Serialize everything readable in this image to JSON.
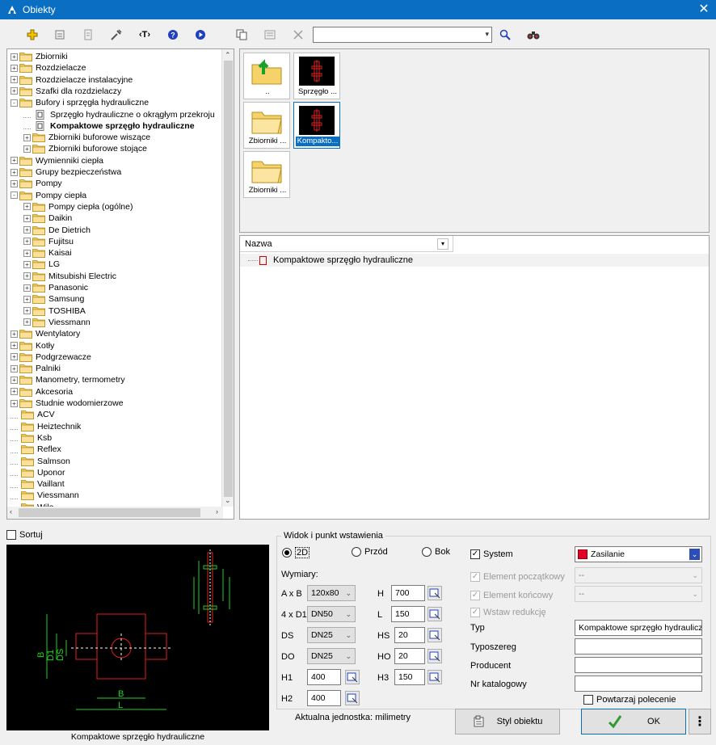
{
  "window": {
    "title": "Obiekty",
    "close": "✕"
  },
  "toolbar": {
    "search_value": ""
  },
  "tree": {
    "items": [
      {
        "label": "Zbiorniki",
        "level": 0,
        "expander": "+",
        "icon": "folder"
      },
      {
        "label": "Rozdzielacze",
        "level": 0,
        "expander": "+",
        "icon": "folder"
      },
      {
        "label": "Rozdzielacze instalacyjne",
        "level": 0,
        "expander": "+",
        "icon": "folder"
      },
      {
        "label": "Szafki dla rozdzielaczy",
        "level": 0,
        "expander": "+",
        "icon": "folder"
      },
      {
        "label": "Bufory i sprzęgła hydrauliczne",
        "level": 0,
        "expander": "-",
        "icon": "folder"
      },
      {
        "label": "Sprzęgło hydrauliczne o okrągłym przekroju",
        "level": 1,
        "expander": "",
        "icon": "file"
      },
      {
        "label": "Kompaktowe sprzęgło hydrauliczne",
        "level": 1,
        "expander": "",
        "icon": "file",
        "bold": true
      },
      {
        "label": "Zbiorniki buforowe wiszące",
        "level": 1,
        "expander": "+",
        "icon": "folder"
      },
      {
        "label": "Zbiorniki buforowe stojące",
        "level": 1,
        "expander": "+",
        "icon": "folder"
      },
      {
        "label": "Wymienniki ciepła",
        "level": 0,
        "expander": "+",
        "icon": "folder"
      },
      {
        "label": "Grupy bezpieczeństwa",
        "level": 0,
        "expander": "+",
        "icon": "folder"
      },
      {
        "label": "Pompy",
        "level": 0,
        "expander": "+",
        "icon": "folder"
      },
      {
        "label": "Pompy ciepła",
        "level": 0,
        "expander": "-",
        "icon": "folder"
      },
      {
        "label": "Pompy ciepła (ogólne)",
        "level": 1,
        "expander": "+",
        "icon": "folder"
      },
      {
        "label": "Daikin",
        "level": 1,
        "expander": "+",
        "icon": "folder"
      },
      {
        "label": "De Dietrich",
        "level": 1,
        "expander": "+",
        "icon": "folder"
      },
      {
        "label": "Fujitsu",
        "level": 1,
        "expander": "+",
        "icon": "folder"
      },
      {
        "label": "Kaisai",
        "level": 1,
        "expander": "+",
        "icon": "folder"
      },
      {
        "label": "LG",
        "level": 1,
        "expander": "+",
        "icon": "folder"
      },
      {
        "label": "Mitsubishi Electric",
        "level": 1,
        "expander": "+",
        "icon": "folder"
      },
      {
        "label": "Panasonic",
        "level": 1,
        "expander": "+",
        "icon": "folder"
      },
      {
        "label": "Samsung",
        "level": 1,
        "expander": "+",
        "icon": "folder"
      },
      {
        "label": "TOSHIBA",
        "level": 1,
        "expander": "+",
        "icon": "folder"
      },
      {
        "label": "Viessmann",
        "level": 1,
        "expander": "+",
        "icon": "folder"
      },
      {
        "label": "Wentylatory",
        "level": 0,
        "expander": "+",
        "icon": "folder"
      },
      {
        "label": "Kotły",
        "level": 0,
        "expander": "+",
        "icon": "folder"
      },
      {
        "label": "Podgrzewacze",
        "level": 0,
        "expander": "+",
        "icon": "folder"
      },
      {
        "label": "Palniki",
        "level": 0,
        "expander": "+",
        "icon": "folder"
      },
      {
        "label": "Manometry, termometry",
        "level": 0,
        "expander": "+",
        "icon": "folder"
      },
      {
        "label": "Akcesoria",
        "level": 0,
        "expander": "+",
        "icon": "folder"
      },
      {
        "label": "Studnie wodomierzowe",
        "level": 0,
        "expander": "+",
        "icon": "folder"
      },
      {
        "label": "ACV",
        "level": 0,
        "expander": "",
        "icon": "folder"
      },
      {
        "label": "Heiztechnik",
        "level": 0,
        "expander": "",
        "icon": "folder"
      },
      {
        "label": "Ksb",
        "level": 0,
        "expander": "",
        "icon": "folder"
      },
      {
        "label": "Reflex",
        "level": 0,
        "expander": "",
        "icon": "folder"
      },
      {
        "label": "Salmson",
        "level": 0,
        "expander": "",
        "icon": "folder"
      },
      {
        "label": "Uponor",
        "level": 0,
        "expander": "",
        "icon": "folder"
      },
      {
        "label": "Vaillant",
        "level": 0,
        "expander": "",
        "icon": "folder"
      },
      {
        "label": "Viessmann",
        "level": 0,
        "expander": "",
        "icon": "folder"
      },
      {
        "label": "Wilo",
        "level": 0,
        "expander": "",
        "icon": "folder"
      }
    ]
  },
  "thumbnails": {
    "up": "..",
    "t1": "Sprzęgło ...",
    "t2": "Zbiorniki ...",
    "t3": "Kompakto...",
    "t4": "Zbiorniki ..."
  },
  "list": {
    "column": "Nazwa",
    "rows": [
      "Kompaktowe sprzęgło hydrauliczne"
    ]
  },
  "sortuj": "Sortuj",
  "preview": {
    "caption": "Kompaktowe sprzęgło hydrauliczne"
  },
  "view": {
    "group_title": "Widok i punkt wstawienia",
    "opt_2d": "2D",
    "opt_front": "Przód",
    "opt_side": "Bok",
    "selected": "2D"
  },
  "dims": {
    "title": "Wymiary:",
    "axb_label": "A x B",
    "axb_value": "120x80",
    "d1_label": "4 x D1",
    "d1_value": "DN50",
    "ds_label": "DS",
    "ds_value": "DN25",
    "do_label": "DO",
    "do_value": "DN25",
    "h1_label": "H1",
    "h1_value": "400",
    "h2_label": "H2",
    "h2_value": "400",
    "h_label": "H",
    "h_value": "700",
    "l_label": "L",
    "l_value": "150",
    "hs_label": "HS",
    "hs_value": "20",
    "ho_label": "HO",
    "ho_value": "20",
    "h3_label": "H3",
    "h3_value": "150"
  },
  "system": {
    "system_label": "System",
    "system_value": "Zasilanie",
    "system_color": "#e0002a",
    "elem_start_label": "Element początkowy",
    "elem_start_value": "--",
    "elem_end_label": "Element końcowy",
    "elem_end_value": "--",
    "reduction_label": "Wstaw redukcję"
  },
  "props": {
    "typ_label": "Typ",
    "typ_value": "Kompaktowe sprzęgło hydrauliczne",
    "typoszereg_label": "Typoszereg",
    "typoszereg_value": "",
    "producent_label": "Producent",
    "producent_value": "",
    "catalog_label": "Nr katalogowy",
    "catalog_value": ""
  },
  "repeat_label": "Powtarzaj polecenie",
  "unit_text": "Aktualna jednostka: milimetry",
  "buttons": {
    "style": "Styl obiektu",
    "ok": "OK",
    "more": "⋮"
  }
}
